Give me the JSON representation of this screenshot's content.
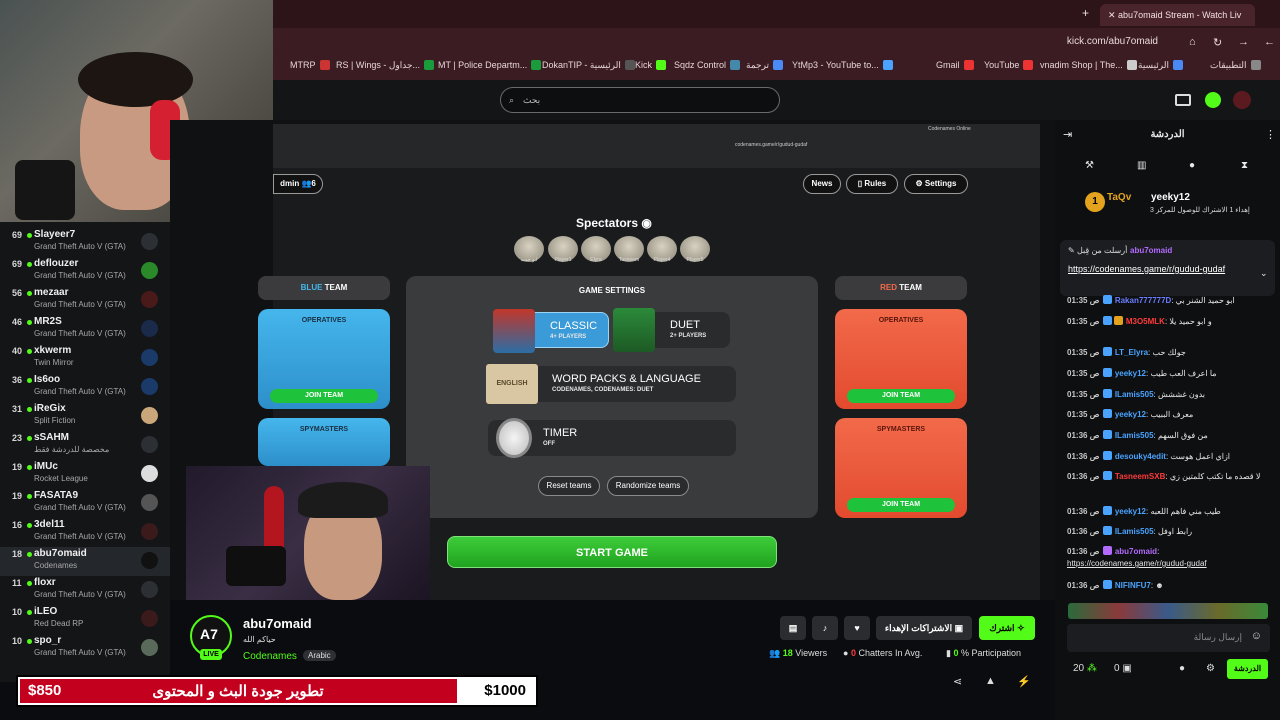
{
  "browser": {
    "tab_title": "abu7omaid Stream - Watch Liv",
    "url": "kick.com/abu7omaid",
    "bookmarks": [
      "MTRP",
      "RS | Wings - جداول...",
      "MT | Police Departm...",
      "DokanTIP - الرئيسية",
      "Kick",
      "Sqdz Control",
      "ترجمة",
      "YtMp3 - YouTube to...",
      "Gmail",
      "YouTube",
      "vnadim Shop | The...",
      "الرئيسية",
      "التطبيقات"
    ]
  },
  "kick": {
    "search_placeholder": "بحث"
  },
  "sidebar": {
    "items": [
      {
        "count": "69",
        "name": "Slayeer7",
        "game": "Grand Theft Auto V (GTA)"
      },
      {
        "count": "69",
        "name": "deflouzer",
        "game": "Grand Theft Auto V (GTA)"
      },
      {
        "count": "56",
        "name": "mezaar",
        "game": "Grand Theft Auto V (GTA)"
      },
      {
        "count": "46",
        "name": "MR2S",
        "game": "Grand Theft Auto V (GTA)"
      },
      {
        "count": "40",
        "name": "xkwerm",
        "game": "Twin Mirror"
      },
      {
        "count": "36",
        "name": "Is6oo",
        "game": "Grand Theft Auto V (GTA)"
      },
      {
        "count": "31",
        "name": "iReGix",
        "game": "Split Fiction"
      },
      {
        "count": "23",
        "name": "sSAHM",
        "game": "مخصصة للدردشة فقط"
      },
      {
        "count": "19",
        "name": "iMUc",
        "game": "Rocket League"
      },
      {
        "count": "19",
        "name": "FASATA9",
        "game": "Grand Theft Auto V (GTA)"
      },
      {
        "count": "16",
        "name": "3del11",
        "game": "Grand Theft Auto V (GTA)"
      },
      {
        "count": "18",
        "name": "abu7omaid",
        "game": "Codenames"
      },
      {
        "count": "11",
        "name": "floxr",
        "game": "Grand Theft Auto V (GTA)"
      },
      {
        "count": "10",
        "name": "iLEO",
        "game": "Red Dead RP"
      },
      {
        "count": "10",
        "name": "spo_r",
        "game": "Grand Theft Auto V (GTA)"
      }
    ]
  },
  "game": {
    "url": "codenames.game/r/gudud-gudaf",
    "tab": "Codenames Online",
    "admin": "dmin",
    "admin_count": "6",
    "news": "News",
    "rules": "Rules",
    "settings": "Settings",
    "spectators_title": "Spectators",
    "spectators": [
      "ابو حميد",
      "Player1",
      "Elyra",
      "Tasneem",
      "Player4",
      "Player5"
    ],
    "blue_team_a": "BLUE",
    "blue_team_b": " TEAM",
    "red_team_a": "RED",
    "red_team_b": " TEAM",
    "operatives": "OPERATIVES",
    "spymasters": "SPYMASTERS",
    "join_team": "JOIN TEAM",
    "game_settings": "GAME SETTINGS",
    "classic": "CLASSIC",
    "classic_sub": "4+ PLAYERS",
    "duet": "DUET",
    "duet_sub": "2+ PLAYERS",
    "english": "ENGLISH",
    "word_packs": "WORD PACKS & LANGUAGE",
    "word_packs_sub": "CODENAMES, CODENAMES: DUET",
    "timer": "TIMER",
    "timer_sub": "OFF",
    "reset_teams": "Reset teams",
    "randomize_teams": "Randomize teams",
    "start_game": "START GAME"
  },
  "stream": {
    "channel": "abu7omaid",
    "greeting": "حياكم الله",
    "category": "Codenames",
    "language": "Arabic",
    "live": "LIVE",
    "subscribe": "اشترك",
    "gift_subs": "الاشتراكات الإهداء",
    "viewers": "18",
    "viewers_label": "Viewers",
    "chatters": "0",
    "chatters_label": "Chatters In Avg.",
    "participation": "0",
    "participation_label": "% Participation"
  },
  "chat": {
    "title": "الدردشة",
    "pinned_user": "abu7omaid",
    "pinned_label": "أرسلت من قِبل",
    "pinned_link": "https://codenames.game/r/gudud-gudaf",
    "top1_user": "TaQv",
    "top2_user": "yeeky12",
    "top_note": "إهداء 1 الاشتراك للوصول للمركز 3",
    "messages": [
      {
        "ts": "01:35 ص",
        "user": "Rakan777777D",
        "color": "#6b7cff",
        "text": ": ابو حميد الشنر بي"
      },
      {
        "ts": "01:35 ص",
        "user": "M3O5MLK",
        "color": "#ff3b3b",
        "text": ": و ابو حميد يلا"
      },
      {
        "ts": "01:35 ص",
        "user": "LT_Elyra",
        "color": "#4aa3ff",
        "text": ": جولك حب"
      },
      {
        "ts": "01:35 ص",
        "user": "yeeky12",
        "color": "#4aa3ff",
        "text": ": ما اعرف العب طيب"
      },
      {
        "ts": "01:35 ص",
        "user": "ILamis505",
        "color": "#4aa3ff",
        "text": ": بدون غششش"
      },
      {
        "ts": "01:35 ص",
        "user": "yeeky12",
        "color": "#4aa3ff",
        "text": ": معرف الببيب"
      },
      {
        "ts": "01:36 ص",
        "user": "ILamis505",
        "color": "#4aa3ff",
        "text": ": من فوق السهم"
      },
      {
        "ts": "01:36 ص",
        "user": "desouky4edit",
        "color": "#4aa3ff",
        "text": ": ازاي اعمل هوست"
      },
      {
        "ts": "01:36 ص",
        "user": "TasneemSXB",
        "color": "#ff3b3b",
        "text": ": لا قصده ما تكتب كلمتين زي"
      },
      {
        "ts": "01:36 ص",
        "user": "yeeky12",
        "color": "#4aa3ff",
        "text": ": طيب مني فاهم اللعبه"
      },
      {
        "ts": "01:36 ص",
        "user": "ILamis505",
        "color": "#4aa3ff",
        "text": ": رابط اوفل"
      },
      {
        "ts": "01:36 ص",
        "user": "abu7omaid",
        "color": "#b36bff",
        "text": ":"
      },
      {
        "ts": "01:36 ص",
        "user": "NIFINFU7",
        "color": "#4aa3ff",
        "text": ":"
      }
    ],
    "last_link": "https://codenames.game/r/gudud-gudaf",
    "input_placeholder": "إرسال رسالة",
    "send_label": "الدردشة",
    "points": "20",
    "zero": "0"
  },
  "donation": {
    "current": "$850",
    "goal": "$1000",
    "label": "تطوير جودة البث و المحتوى",
    "progress": 0.85
  },
  "colors": {
    "kick_green": "#53fc18",
    "donation_red": "#c3001d"
  }
}
